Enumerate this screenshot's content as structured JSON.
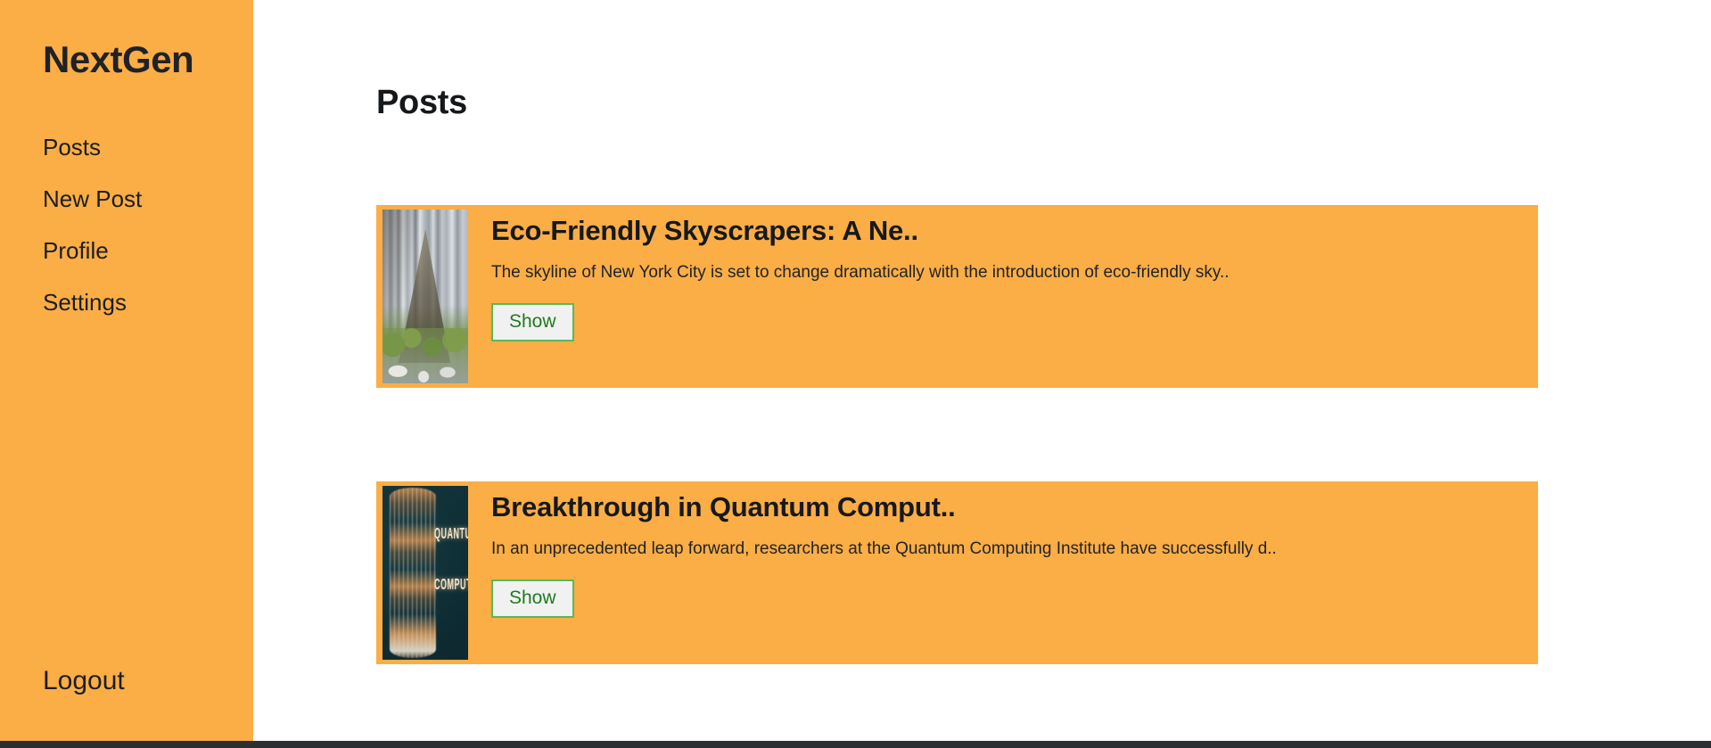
{
  "colors": {
    "sidebar_bg": "#FBAD46",
    "card_bg": "#FBAD46",
    "page_bg": "#FFFFFF",
    "text": "#16191C",
    "button_border": "#5CB85C",
    "button_text": "#1F7A1F",
    "button_bg": "#F1F1F1",
    "bottom_bar": "#2B2F33"
  },
  "sidebar": {
    "brand": "NextGen",
    "items": [
      {
        "label": "Posts"
      },
      {
        "label": "New Post"
      },
      {
        "label": "Profile"
      },
      {
        "label": "Settings"
      }
    ],
    "logout_label": "Logout"
  },
  "main": {
    "page_title": "Posts",
    "posts": [
      {
        "title": "Eco-Friendly Skyscrapers: A Ne..",
        "excerpt": "The skyline of New York City is set to change dramatically with the introduction of eco-friendly sky..",
        "button_label": "Show",
        "thumbnail_name": "eco-skyscraper-thumbnail"
      },
      {
        "title": "Breakthrough in Quantum Comput..",
        "excerpt": "In an unprecedented leap forward, researchers at the Quantum Computing Institute have successfully d..",
        "button_label": "Show",
        "thumbnail_name": "quantum-computing-thumbnail"
      }
    ]
  }
}
